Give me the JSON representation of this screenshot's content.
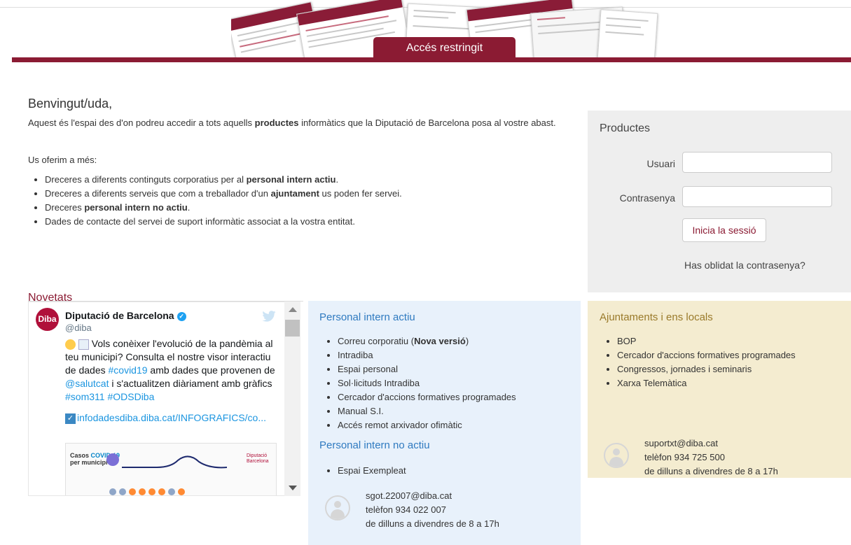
{
  "header": {
    "tab_label": "Accés restringit",
    "colors": {
      "brand": "#8b1b33"
    }
  },
  "intro": {
    "welcome": "Benvingut/uda,",
    "text_before": "Aquest és l'espai des d'on podreu accedir a tots aquells ",
    "text_bold": "productes",
    "text_after": " informàtics que la Diputació de Barcelona posa al vostre abast.",
    "offer": "Us oferim a més:",
    "bullets": [
      {
        "before": "Dreceres a diferents continguts corporatius per al ",
        "bold": "personal intern actiu",
        "after": "."
      },
      {
        "before": "Dreceres a diferents serveis que com a treballador d'un ",
        "bold": "ajuntament",
        "after": " us poden fer servei."
      },
      {
        "before": "Dreceres ",
        "bold": "personal intern no actiu",
        "after": "."
      },
      {
        "before": "Dades de contacte del servei de suport informàtic associat a la vostra entitat.",
        "bold": "",
        "after": ""
      }
    ]
  },
  "login": {
    "title": "Productes",
    "user_label": "Usuari",
    "password_label": "Contrasenya",
    "user_value": "",
    "password_value": "",
    "submit_label": "Inicia la sessió",
    "forgot_label": "Has oblidat la contrasenya?"
  },
  "news": {
    "title": "Novetats",
    "tweet": {
      "avatar_text": "Diba",
      "name": "Diputació de Barcelona",
      "handle": "@diba",
      "text_1": " Vols conèixer l'evolució de la pandèmia al teu municipi? Consulta el nostre visor interactiu de dades ",
      "tag_covid": "#covid19",
      "text_2": " amb dades que provenen de ",
      "tag_salut": "@salutcat",
      "text_3": " i s'actualitzen diàriament amb gràfics ",
      "tag_som": "#som311",
      "tag_ods": "#ODSDiba",
      "link": "infodadesdiba.diba.cat/INFOGRAFICS/co...",
      "media_title_1": "Casos ",
      "media_title_covid": "COVID-19",
      "media_title_2": "per municipi",
      "media_logo_1": "Diputació",
      "media_logo_2": "Barcelona"
    }
  },
  "personal_actiu": {
    "title": "Personal intern actiu",
    "items": [
      "Correu corporatiu (",
      "Intradiba",
      "Espai personal",
      "Sol·licituds Intradiba",
      "Cercador d'accions formatives programades",
      "Manual S.I.",
      "Accés remot arxivador ofimàtic"
    ],
    "item0_bold": "Nova versió",
    "item0_after": ")"
  },
  "personal_no_actiu": {
    "title": "Personal intern no actiu",
    "items": [
      "Espai Exempleat"
    ],
    "contact": {
      "email": "sgot.22007@diba.cat",
      "phone": "telèfon 934 022 007",
      "hours": "de dilluns a divendres de 8 a 17h"
    }
  },
  "ajuntaments": {
    "title": "Ajuntaments i ens locals",
    "items": [
      "BOP",
      "Cercador d'accions formatives programades",
      "Congressos, jornades i seminaris",
      "Xarxa Telemàtica"
    ],
    "contact": {
      "email": "suportxt@diba.cat",
      "phone": "telèfon 934 725 500",
      "hours": "de dilluns a divendres de 8 a 17h"
    }
  }
}
